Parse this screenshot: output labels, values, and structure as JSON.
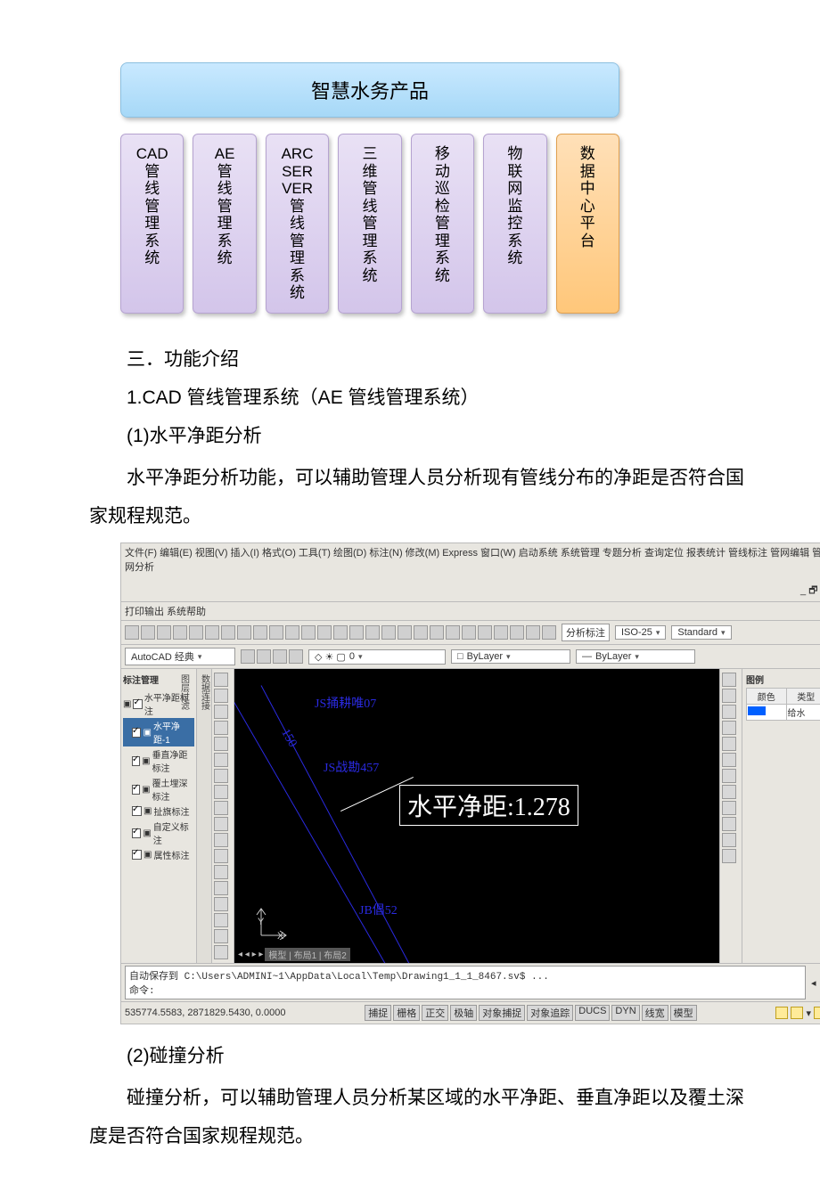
{
  "diagram": {
    "title": "智慧水务产品",
    "items": [
      {
        "l1": "CAD",
        "rest": [
          "管",
          "线",
          "管",
          "理",
          "系",
          "统"
        ]
      },
      {
        "l1": "AE",
        "rest": [
          "管",
          "线",
          "管",
          "理",
          "系",
          "统"
        ]
      },
      {
        "l1": "ARC",
        "l2": "SER",
        "l3": "VER",
        "rest": [
          "管",
          "线",
          "管",
          "理",
          "系",
          "统"
        ]
      },
      {
        "rest": [
          "三",
          "维",
          "管",
          "线",
          "管",
          "理",
          "系",
          "统"
        ]
      },
      {
        "rest": [
          "移",
          "动",
          "巡",
          "检",
          "管",
          "理",
          "系",
          "统"
        ]
      },
      {
        "rest": [
          "物",
          "联",
          "网",
          "监",
          "控",
          "系",
          "统"
        ]
      },
      {
        "rest": [
          "数",
          "据",
          "中",
          "心",
          "平",
          "台"
        ],
        "orange": true
      }
    ]
  },
  "body": {
    "h1": "三．功能介绍",
    "h2": "1.CAD 管线管理系统（AE 管线管理系统）",
    "h3": "(1)水平净距分析",
    "p1": "水平净距分析功能，可以辅助管理人员分析现有管线分布的净距是否符合国家规程规范。",
    "h4": "(2)碰撞分析",
    "p2": "碰撞分析，可以辅助管理人员分析某区域的水平净距、垂直净距以及覆土深度是否符合国家规程规范。"
  },
  "cad": {
    "menus": [
      "文件(F)",
      "编辑(E)",
      "视图(V)",
      "插入(I)",
      "格式(O)",
      "工具(T)",
      "绘图(D)",
      "标注(N)",
      "修改(M)",
      "Express",
      "窗口(W)",
      "启动系统",
      "系统管理",
      "专题分析",
      "查询定位",
      "报表统计",
      "管线标注",
      "管网编辑",
      "管网分析"
    ],
    "menus2": [
      "打印输出",
      "系统帮助"
    ],
    "close": "_ 🗗 ×",
    "workspace": "AutoCAD 经典",
    "analysis_btn": "分析标注",
    "iso": "ISO-25",
    "std": "Standard",
    "layer0": "0",
    "bylayer": "ByLayer",
    "left": {
      "title": "标注管理",
      "root": "水平净距标注",
      "items": [
        "水平净距-1",
        "垂直净距标注",
        "覆土埋深标注",
        "扯旗标注",
        "自定义标注",
        "属性标注"
      ]
    },
    "vtabs": [
      "图层组",
      "数据连接",
      "图层过滤"
    ],
    "canvas": {
      "node1": "JS捅耕唯07",
      "node2": "JS战勘457",
      "node3": "JB倡52",
      "dim": "水平净距:1.278",
      "s150": "150",
      "tabs": "模型 | 布局1 | 布局2"
    },
    "right": {
      "title": "图例",
      "cols": [
        "颜色",
        "类型"
      ],
      "row": "给水",
      "color": "#0060ff"
    },
    "rtool_icons": 12,
    "cmd": {
      "line1": "自动保存到 C:\\Users\\ADMINI~1\\AppData\\Local\\Temp\\Drawing1_1_1_8467.sv$ ...",
      "line2": "命令:"
    },
    "status": {
      "coord": "535774.5583, 2871829.5430, 0.0000",
      "snaps": [
        "捕捉",
        "栅格",
        "正交",
        "极轴",
        "对象捕捉",
        "对象追踪",
        "DUCS",
        "DYN",
        "线宽",
        "模型"
      ]
    }
  }
}
